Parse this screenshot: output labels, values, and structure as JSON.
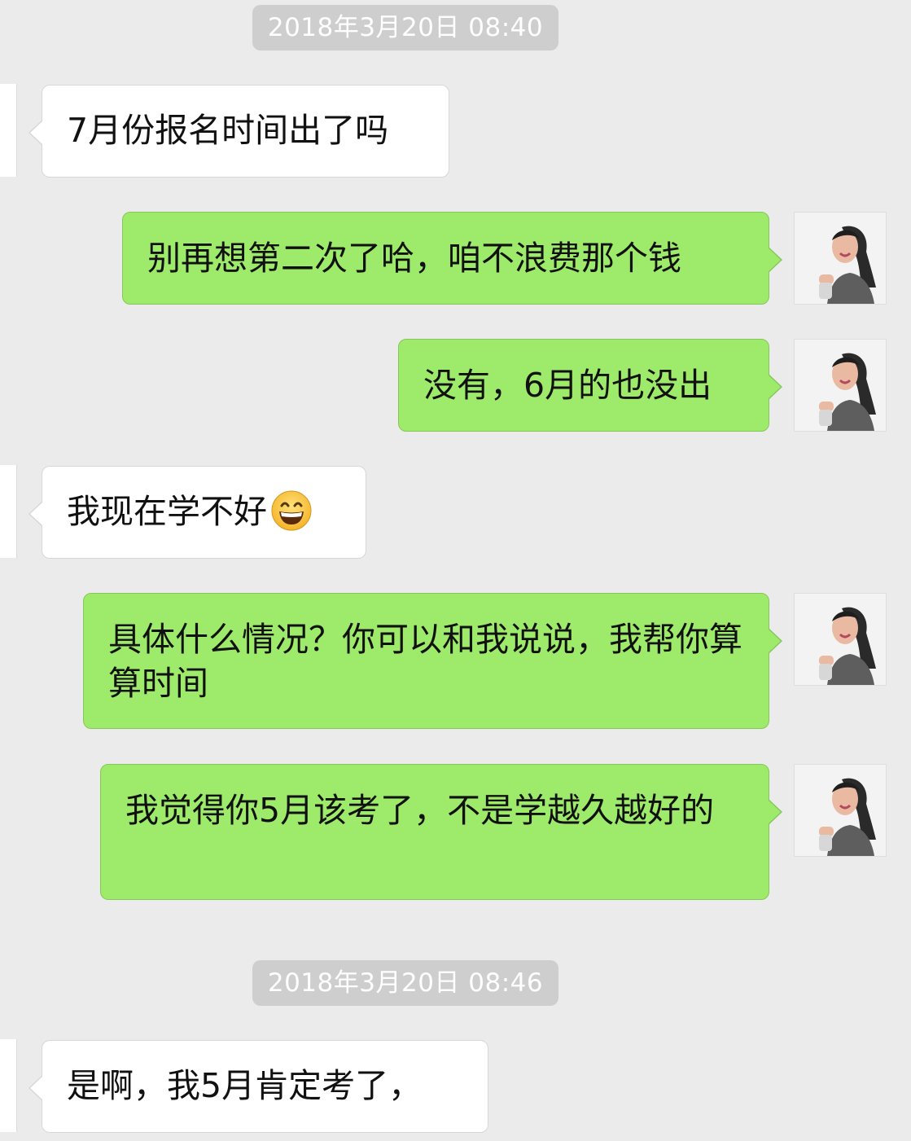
{
  "chat": {
    "timestamps": [
      "2018年3月20日 08:40",
      "2018年3月20日 08:46"
    ],
    "messages": [
      {
        "sender": "other",
        "text": "7月份报名时间出了吗"
      },
      {
        "sender": "me",
        "text": "别再想第二次了哈，咱不浪费那个钱"
      },
      {
        "sender": "me",
        "text": "没有，6月的也没出"
      },
      {
        "sender": "other",
        "text": "我现在学不好",
        "emoji": "grinning-face-emoji"
      },
      {
        "sender": "me",
        "text": "具体什么情况？你可以和我说说，我帮你算算时间"
      },
      {
        "sender": "me",
        "text": "我觉得你5月该考了，不是学越久越好的"
      },
      {
        "sender": "other",
        "text": "是啊，我5月肯定考了，"
      }
    ]
  },
  "colors": {
    "background": "#ebebeb",
    "outgoing_bubble": "#9eea6a",
    "incoming_bubble": "#ffffff",
    "timestamp_pill": "#cecece"
  }
}
